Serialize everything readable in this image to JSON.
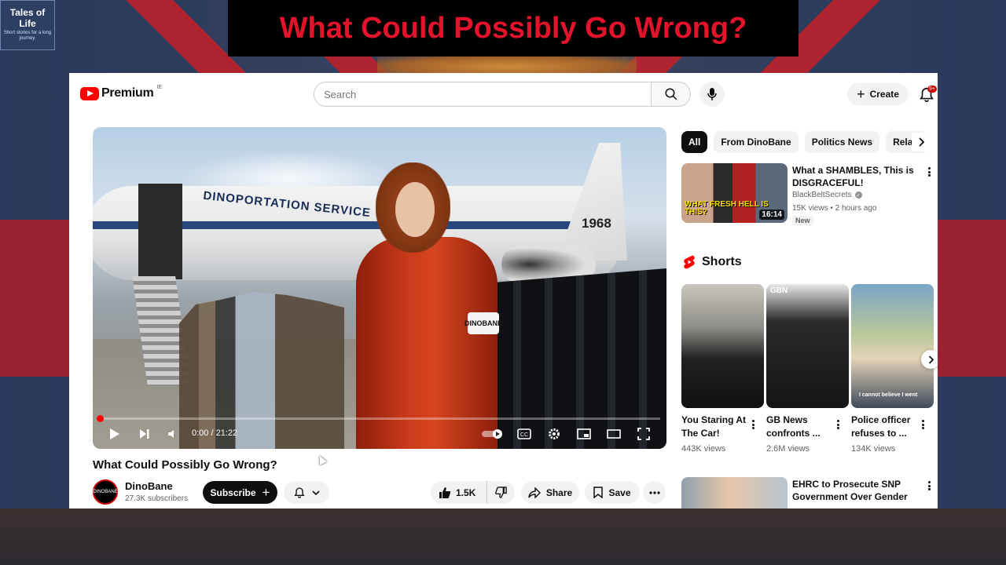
{
  "overlay": {
    "channel_logo_title": "Tales of Life",
    "channel_logo_tagline": "Short stories for a long journey.",
    "banner_title": "What Could Possibly Go Wrong?"
  },
  "header": {
    "logo_text": "Premium",
    "region": "IE",
    "search_placeholder": "Search",
    "create_label": "Create",
    "notification_count": "9+"
  },
  "player": {
    "scene_text_plane": "DINOPORTATION SERVICE",
    "scene_text_tail": "1968",
    "scene_text_armband": "DINOBANE",
    "time_display": "0:00 / 21:22",
    "progress_fraction": 0.0
  },
  "video": {
    "title": "What Could Possibly Go Wrong?",
    "channel_name": "DinoBane",
    "channel_avatar_text": "DINOBANE",
    "subscribers": "27.3K subscribers",
    "subscribe_label": "Subscribe",
    "like_count": "1.5K",
    "share_label": "Share",
    "save_label": "Save"
  },
  "chips": [
    "All",
    "From DinoBane",
    "Politics News",
    "Relate"
  ],
  "recommended": [
    {
      "title": "What a SHAMBLES, This is DISGRACEFUL!",
      "channel": "BlackBeltSecrets",
      "meta": "15K views • 2 hours ago",
      "badge": "New",
      "duration": "16:14",
      "thumb_text": "WHAT FRESH HELL IS THIS?"
    },
    {
      "title": "EHRC to Prosecute SNP Government Over Gender ..."
    }
  ],
  "shorts": {
    "heading": "Shorts",
    "items": [
      {
        "title": "You Staring At The Car!",
        "views": "443K views"
      },
      {
        "title": "GB News confronts ...",
        "views": "2.6M views",
        "thumb_logo": "GBN"
      },
      {
        "title": "Police officer refuses to ...",
        "views": "134K views",
        "thumb_caption": "I cannot believe I went"
      }
    ]
  }
}
